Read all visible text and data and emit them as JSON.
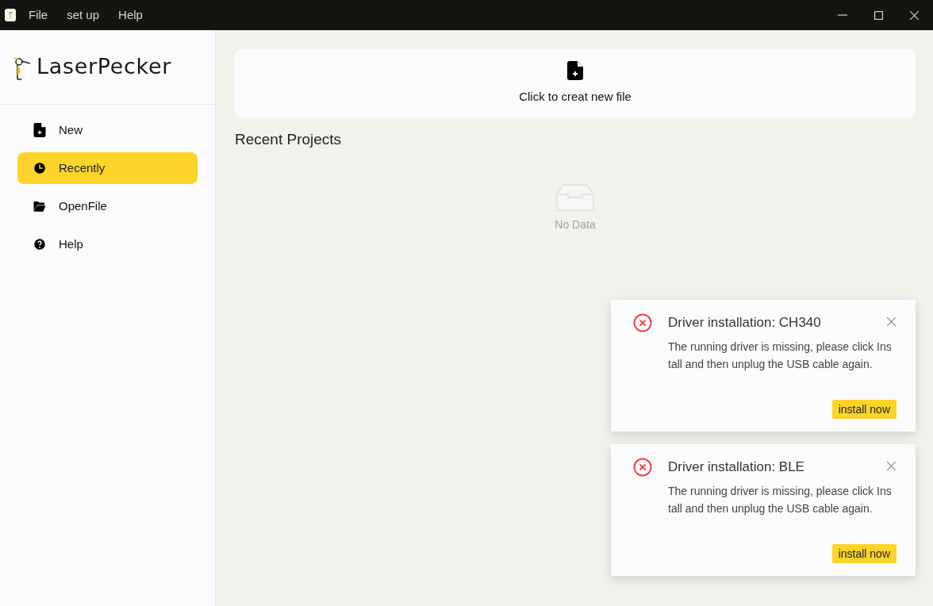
{
  "menu_bar": {
    "items": [
      "File",
      "set up",
      "Help"
    ]
  },
  "sidebar": {
    "logo": "LaserPecker",
    "items": [
      {
        "label": "New",
        "kind": "new",
        "selected": false
      },
      {
        "label": "Recently",
        "kind": "recent",
        "selected": true
      },
      {
        "label": "OpenFile",
        "kind": "open",
        "selected": false
      },
      {
        "label": "Help",
        "kind": "help",
        "selected": false
      }
    ]
  },
  "new_file_card": {
    "label": "Click to creat new file"
  },
  "recent_projects": {
    "title": "Recent Projects",
    "empty_text": "No Data"
  },
  "notifications": [
    {
      "title": "Driver installation: CH340",
      "message": "The running driver is missing, please click Install and then unplug the USB cable again.",
      "button": "install now"
    },
    {
      "title": "Driver installation: BLE",
      "message": "The running driver is missing, please click Install and then unplug the USB cable again.",
      "button": "install now"
    }
  ]
}
